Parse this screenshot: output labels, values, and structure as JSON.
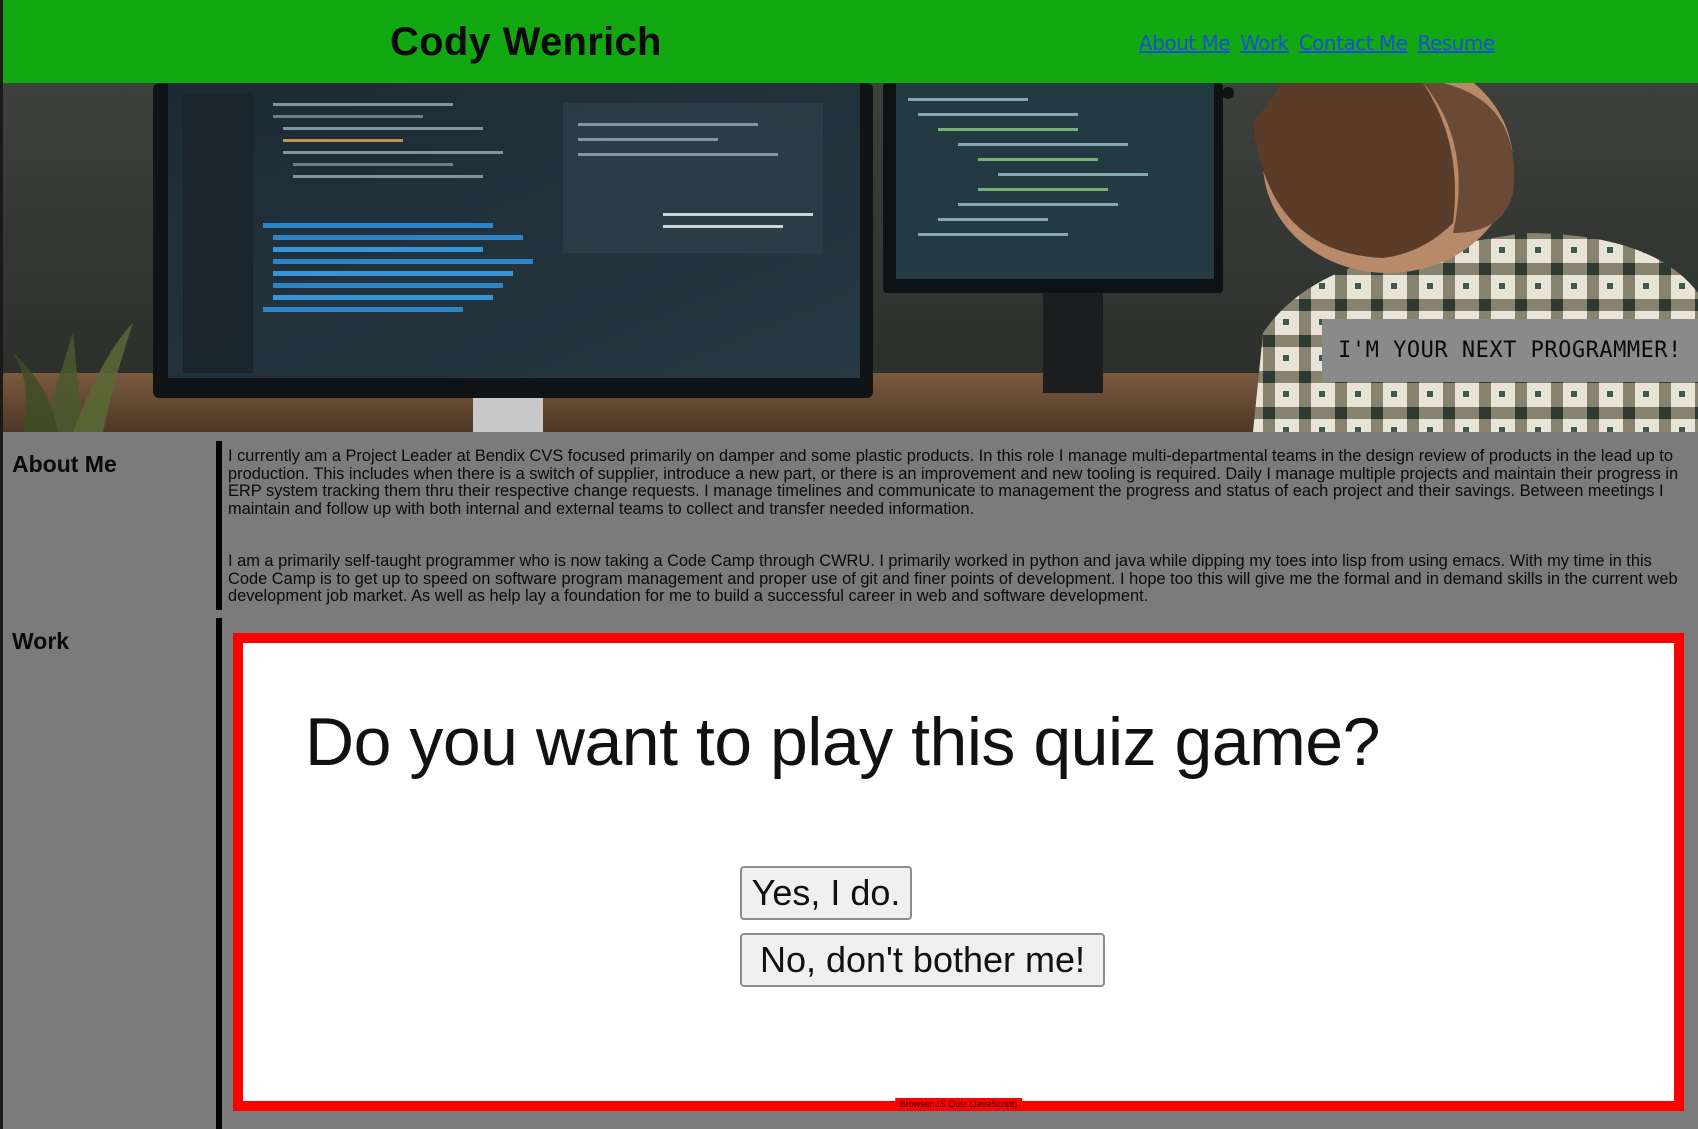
{
  "header": {
    "site_title": "Cody Wenrich",
    "nav": [
      {
        "label": "About Me"
      },
      {
        "label": "Work"
      },
      {
        "label": "Contact Me"
      },
      {
        "label": "Resume"
      }
    ]
  },
  "hero": {
    "tagline": "I'M YOUR NEXT PROGRAMMER!"
  },
  "about": {
    "heading": "About Me",
    "paragraphs": [
      "I currently am a Project Leader at Bendix CVS focused primarily on damper and some plastic products. In this role I manage multi-departmental teams in the design review of products in the lead up to production. This includes when there is a switch of supplier, introduce a new part, or there is an improvement and new tooling is required. Daily I manage multiple projects and maintain their progress in ERP system tracking them thru their respective change requests. I manage timelines and communicate to management the progress and status of each project and their savings. Between meetings I maintain and follow up with both internal and external teams to collect and transfer needed information.",
      "I am a primarily self-taught programmer who is now taking a Code Camp through CWRU. I primarily worked in python and java while dipping my toes into lisp from using emacs. With my time in this Code Camp is to get up to speed on software program management and proper use of git and finer points of development. I hope too this will give me the formal and in demand skills in the current web development job market. As well as help lay a foundation for me to build a successful career in web and software development."
    ]
  },
  "work": {
    "heading": "Work",
    "project": {
      "question": "Do you want to play this quiz game?",
      "yes_label": "Yes, I do.",
      "no_label": "No, don't bother me!",
      "caption": "Browser JS Quiz (JavaScript)"
    }
  },
  "colors": {
    "header_bg": "#12a812",
    "nav_link": "#1a4fd6",
    "page_bg": "#7b7b7b",
    "card_border": "#ff0000"
  }
}
